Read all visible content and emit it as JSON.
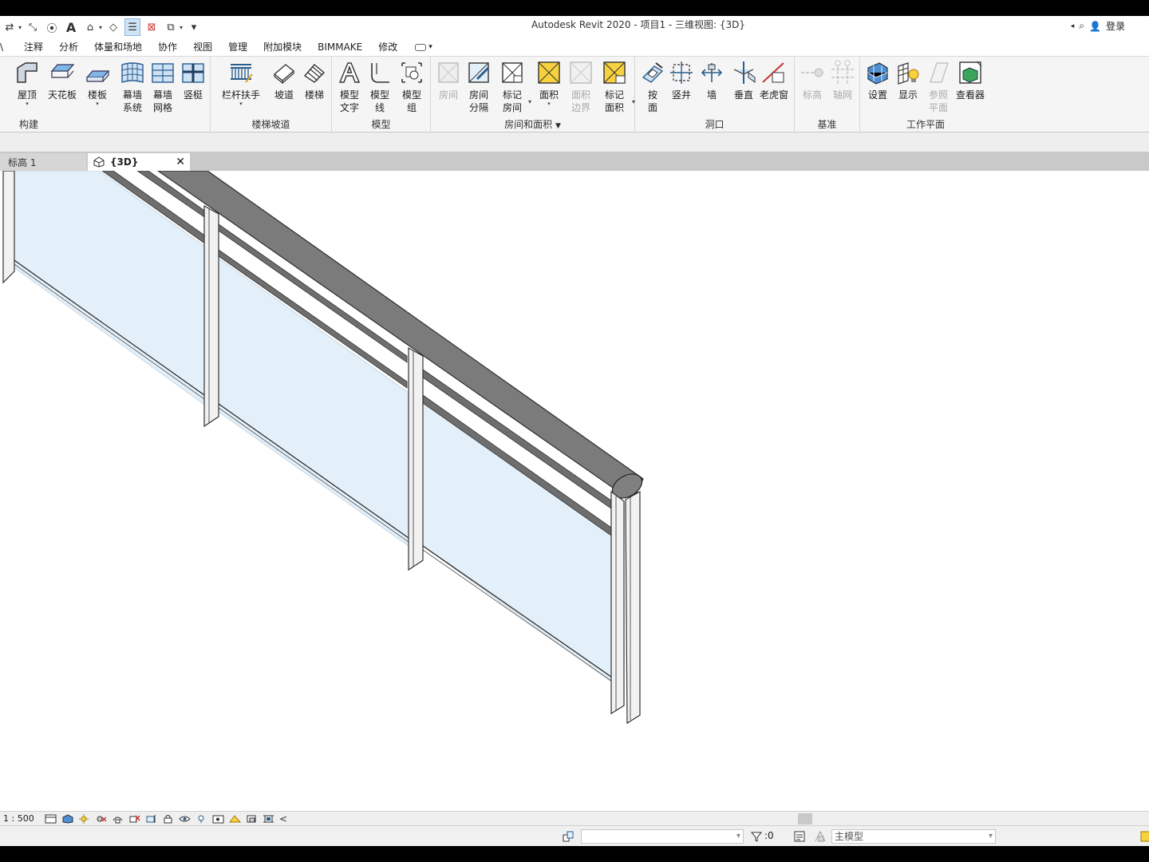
{
  "window": {
    "title": "Autodesk Revit 2020 - 项目1 - 三维视图: {3D}",
    "signin": "登录"
  },
  "quick_access": {
    "icons": [
      "align-icon",
      "measure-icon",
      "dimension-icon",
      "text-icon",
      "3d-view-icon",
      "section-icon",
      "thin-lines-icon",
      "close-hidden-icon",
      "switch-windows-icon",
      "customize-icon"
    ]
  },
  "ribbon_tabs": [
    "注释",
    "分析",
    "体量和场地",
    "协作",
    "视图",
    "管理",
    "附加模块",
    "BIMMAKE",
    "修改"
  ],
  "groups": {
    "build": {
      "label": "构建",
      "tools": [
        {
          "label": "屋顶",
          "icon": "roof-icon"
        },
        {
          "label": "天花板",
          "icon": "ceiling-icon"
        },
        {
          "label": "楼板",
          "icon": "floor-icon"
        },
        {
          "label": "幕墙\n系统",
          "icon": "curtain-system-icon"
        },
        {
          "label": "幕墙\n网格",
          "icon": "curtain-grid-icon"
        },
        {
          "label": "竖梃",
          "icon": "mullion-icon"
        }
      ]
    },
    "circulation": {
      "label": "楼梯坡道",
      "tools": [
        {
          "label": "栏杆扶手",
          "icon": "railing-icon"
        },
        {
          "label": "坡道",
          "icon": "ramp-icon"
        },
        {
          "label": "楼梯",
          "icon": "stair-icon"
        }
      ]
    },
    "model": {
      "label": "模型",
      "tools": [
        {
          "label": "模型\n文字",
          "icon": "model-text-icon"
        },
        {
          "label": "模型\n线",
          "icon": "model-line-icon"
        },
        {
          "label": "模型\n组",
          "icon": "model-group-icon"
        }
      ]
    },
    "room_area": {
      "label": "房间和面积",
      "tools": [
        {
          "label": "房间",
          "icon": "room-icon",
          "disabled": true
        },
        {
          "label": "房间\n分隔",
          "icon": "room-separator-icon"
        },
        {
          "label": "标记\n房间",
          "icon": "tag-room-icon"
        },
        {
          "label": "面积",
          "icon": "area-icon"
        },
        {
          "label": "面积\n边界",
          "icon": "area-boundary-icon",
          "disabled": true
        },
        {
          "label": "标记\n面积",
          "icon": "tag-area-icon"
        }
      ]
    },
    "opening": {
      "label": "洞口",
      "tools": [
        {
          "label": "按\n面",
          "icon": "by-face-icon"
        },
        {
          "label": "竖井",
          "icon": "shaft-icon"
        },
        {
          "label": "墙",
          "icon": "wall-opening-icon"
        },
        {
          "label": "垂直",
          "icon": "vertical-icon"
        },
        {
          "label": "老虎窗",
          "icon": "dormer-icon"
        }
      ]
    },
    "datum": {
      "label": "基准",
      "tools": [
        {
          "label": "标高",
          "icon": "level-icon",
          "disabled": true
        },
        {
          "label": "轴网",
          "icon": "grid-icon",
          "disabled": true
        }
      ]
    },
    "workplane": {
      "label": "工作平面",
      "tools": [
        {
          "label": "设置",
          "icon": "set-workplane-icon"
        },
        {
          "label": "显示",
          "icon": "show-workplane-icon"
        },
        {
          "label": "参照\n平面",
          "icon": "ref-plane-icon",
          "disabled": true
        },
        {
          "label": "查看器",
          "icon": "viewer-icon"
        }
      ]
    }
  },
  "view_tabs": [
    {
      "label": "标高 1",
      "icon": "floor-plan-icon"
    },
    {
      "label": "{3D}",
      "icon": "3d-view-icon",
      "active": true
    }
  ],
  "view_control": {
    "scale": "1 : 500"
  },
  "status": {
    "selection_count": ":0",
    "workset": "",
    "model": "主模型"
  },
  "colors": {
    "glass": "#e4f0f9",
    "handrail": "#7b7b7b",
    "rail": "#6e6e6e",
    "post": "#f2f2f2",
    "accent_yellow": "#f7d23e"
  }
}
